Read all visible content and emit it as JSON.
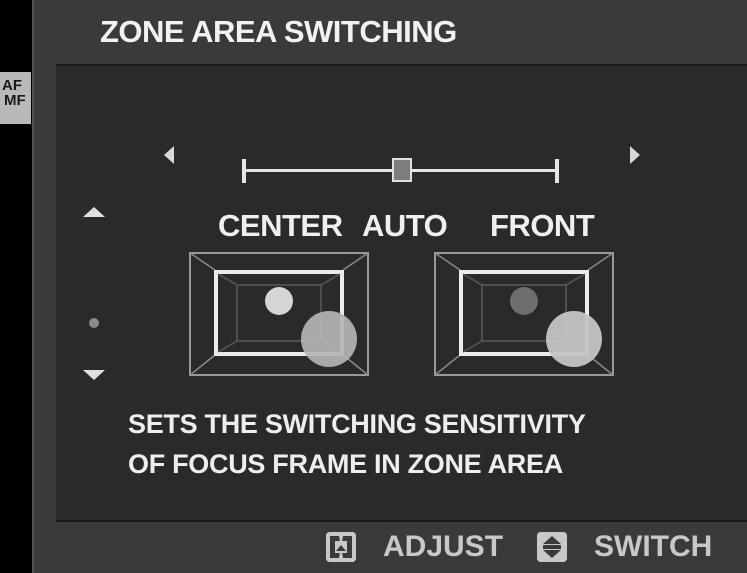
{
  "header": {
    "title": "ZONE AREA SWITCHING"
  },
  "side_badge": {
    "line1": "AF",
    "line2": "MF"
  },
  "slider": {
    "options": [
      "CENTER",
      "AUTO",
      "FRONT"
    ],
    "selected": "AUTO",
    "position_fraction": 0.5
  },
  "description": {
    "line1": "SETS THE SWITCHING SENSITIVITY",
    "line2": "OF FOCUS FRAME IN ZONE AREA"
  },
  "footer": {
    "adjust": {
      "icon": "dpad-left-right-icon",
      "label": "ADJUST"
    },
    "switch": {
      "icon": "dpad-up-down-icon",
      "label": "SWITCH"
    }
  },
  "colors": {
    "background": "#2a2a2a",
    "bar": "#3a3a3a",
    "text": "#f0f0f0",
    "badge": "#b9b9b9"
  }
}
